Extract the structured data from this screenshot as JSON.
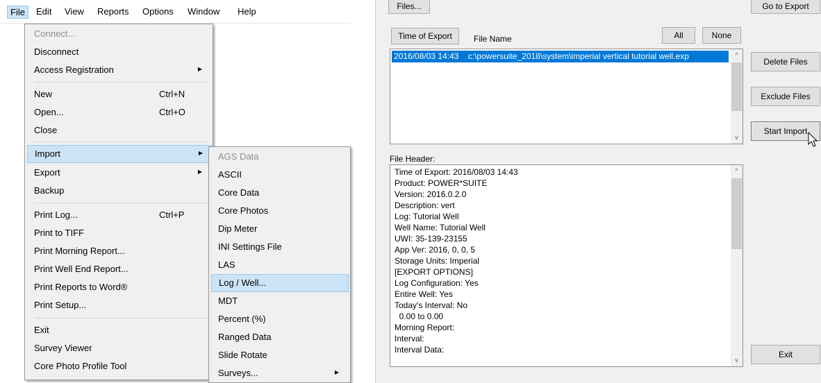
{
  "menubar": {
    "items": [
      "File",
      "Edit",
      "View",
      "Reports",
      "Options",
      "Window",
      "Help"
    ]
  },
  "file_menu": {
    "items": [
      {
        "label": "Connect...",
        "shortcut": "",
        "submenu": false,
        "disabled": true
      },
      {
        "label": "Disconnect",
        "shortcut": "",
        "submenu": false,
        "disabled": false
      },
      {
        "label": "Access Registration",
        "shortcut": "",
        "submenu": true,
        "disabled": false
      },
      {
        "label": "New",
        "shortcut": "Ctrl+N",
        "submenu": false,
        "disabled": false
      },
      {
        "label": "Open...",
        "shortcut": "Ctrl+O",
        "submenu": false,
        "disabled": false
      },
      {
        "label": "Close",
        "shortcut": "",
        "submenu": false,
        "disabled": false
      },
      {
        "label": "Import",
        "shortcut": "",
        "submenu": true,
        "disabled": false,
        "highlighted": true
      },
      {
        "label": "Export",
        "shortcut": "",
        "submenu": true,
        "disabled": false
      },
      {
        "label": "Backup",
        "shortcut": "",
        "submenu": false,
        "disabled": false
      },
      {
        "label": "Print Log...",
        "shortcut": "Ctrl+P",
        "submenu": false,
        "disabled": false
      },
      {
        "label": "Print to TIFF",
        "shortcut": "",
        "submenu": false,
        "disabled": false
      },
      {
        "label": "Print Morning Report...",
        "shortcut": "",
        "submenu": false,
        "disabled": false
      },
      {
        "label": "Print Well End Report...",
        "shortcut": "",
        "submenu": false,
        "disabled": false
      },
      {
        "label": "Print Reports to Word®",
        "shortcut": "",
        "submenu": false,
        "disabled": false
      },
      {
        "label": "Print Setup...",
        "shortcut": "",
        "submenu": false,
        "disabled": false
      },
      {
        "label": "Exit",
        "shortcut": "",
        "submenu": false,
        "disabled": false
      },
      {
        "label": "Survey Viewer",
        "shortcut": "",
        "submenu": false,
        "disabled": false
      },
      {
        "label": "Core Photo Profile Tool",
        "shortcut": "",
        "submenu": false,
        "disabled": false
      }
    ]
  },
  "import_menu": {
    "items": [
      {
        "label": "AGS Data",
        "disabled": true
      },
      {
        "label": "ASCII"
      },
      {
        "label": "Core Data"
      },
      {
        "label": "Core Photos"
      },
      {
        "label": "Dip Meter"
      },
      {
        "label": "INI Settings File"
      },
      {
        "label": "LAS"
      },
      {
        "label": "Log / Well...",
        "highlighted": true
      },
      {
        "label": "MDT"
      },
      {
        "label": "Percent (%)"
      },
      {
        "label": "Ranged Data"
      },
      {
        "label": "Slide Rotate"
      },
      {
        "label": "Surveys...",
        "submenu": true
      }
    ]
  },
  "dialog": {
    "files_button": "Files...",
    "go_to_export_button": "Go to Export",
    "time_of_export_button": "Time of Export",
    "file_name_label": "File Name",
    "all_button": "All",
    "none_button": "None",
    "file_list": [
      {
        "time": "2016/08/03 14:43",
        "path": "c:\\powersuite_2018\\system\\imperial vertical tutorial well.exp",
        "selected": true
      }
    ],
    "delete_files_button": "Delete Files",
    "exclude_files_button": "Exclude Files",
    "start_import_button": "Start Import",
    "file_header_label": "File Header:",
    "file_header_lines": [
      "Time of Export: 2016/08/03 14:43",
      "Product: POWER*SUITE",
      "Version: 2016.0.2.0",
      "Description: vert",
      "Log: Tutorial Well",
      "Well Name: Tutorial Well",
      "UWI: 35-139-23155",
      "App Ver: 2016, 0, 0, 5",
      "Storage Units: Imperial",
      "[EXPORT OPTIONS]",
      "Log Configuration: Yes",
      "Entire Well: Yes",
      "Today's Interval: No",
      "  0.00 to 0.00",
      "Morning Report:",
      "Interval:",
      "Interval Data:"
    ],
    "exit_button": "Exit"
  },
  "colors": {
    "menu_highlight": "#cce4f7",
    "list_selection": "#0078d7",
    "dialog_bg": "#f0f0f0"
  }
}
